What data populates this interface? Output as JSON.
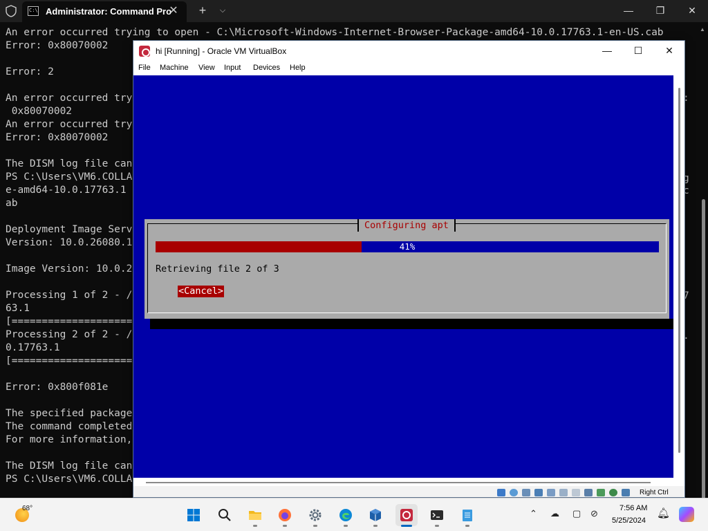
{
  "terminal": {
    "tab_title": "Administrator: Command Pro",
    "lines": [
      "An error occurred trying to open - C:\\Microsoft-Windows-Internet-Browser-Package-amd64-10.0.17763.1-en-US.cab",
      "Error: 0x80070002",
      "",
      "Error: 2",
      "",
      "An error occurred try",
      " 0x80070002",
      "An error occurred try",
      "Error: 0x80070002",
      "",
      "The DISM log file can",
      "PS C:\\Users\\VM6.COLLA",
      "e-amd64-10.0.17763.1",
      "ab",
      "",
      "Deployment Image Serv",
      "Version: 10.0.26080.1",
      "",
      "Image Version: 10.0.2",
      "",
      "Processing 1 of 2 - /",
      "63.1",
      "[=====================",
      "Processing 2 of 2 - /",
      "0.17763.1",
      "[=====================",
      "",
      "Error: 0x800f081e",
      "",
      "The specified package",
      "The command completed",
      "For more information,",
      "",
      "The DISM log file can",
      "PS C:\\Users\\VM6.COLLA"
    ],
    "right_fragments": [
      ":",
      "g",
      "c",
      "7",
      "."
    ]
  },
  "vbox": {
    "title": "hi [Running] - Oracle VM VirtualBox",
    "menu": [
      "File",
      "Machine",
      "View",
      "Input",
      "Devices",
      "Help"
    ],
    "host_key": "Right Ctrl"
  },
  "installer": {
    "dialog_title": "Configuring apt",
    "progress_text": "41%",
    "progress_fraction": 0.41,
    "message": "Retrieving file 2 of 3",
    "cancel_label": "<Cancel>"
  },
  "taskbar": {
    "weather_temp": "68°",
    "time": "7:56 AM",
    "date": "5/25/2024"
  },
  "colors": {
    "vm_background": "#0000a8",
    "dialog_gray": "#aaaaaa",
    "accent_red": "#a80000"
  }
}
